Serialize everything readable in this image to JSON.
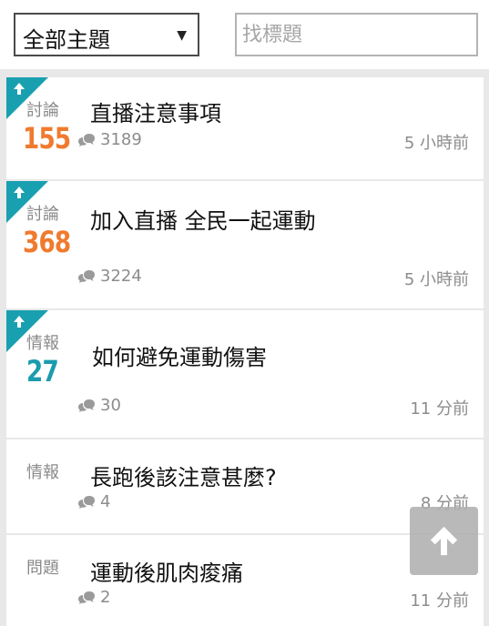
{
  "filter": {
    "selected": "全部主題",
    "caret": "▼"
  },
  "search": {
    "placeholder": "找標題"
  },
  "posts": [
    {
      "category": "討論",
      "number": "155",
      "title": "直播注意事項",
      "comments": "3189",
      "time": "5 小時前",
      "pinned": true,
      "number_color": "#f07a2e"
    },
    {
      "category": "討論",
      "number": "368",
      "title": "加入直播  全民一起運動",
      "comments": "3224",
      "time": "5 小時前",
      "pinned": true,
      "number_color": "#f07a2e"
    },
    {
      "category": "情報",
      "number": "27",
      "title": "如何避免運動傷害",
      "comments": "30",
      "time": "11 分前",
      "pinned": true,
      "number_color": "#1a9cae"
    },
    {
      "category": "情報",
      "number": "",
      "title": "長跑後該注意甚麼?",
      "comments": "4",
      "time": "8 分前",
      "pinned": false,
      "number_color": ""
    },
    {
      "category": "問題",
      "number": "",
      "title": "運動後肌肉痠痛",
      "comments": "2",
      "time": "11 分前",
      "pinned": false,
      "number_color": ""
    }
  ],
  "icons": {
    "pin": "arrow-up-icon",
    "comment": "comment-icon",
    "back_to_top": "arrow-up-icon"
  },
  "colors": {
    "pin_accent": "#19a0b0",
    "hot_number": "#f07a2e",
    "info_number": "#1a9cae"
  }
}
